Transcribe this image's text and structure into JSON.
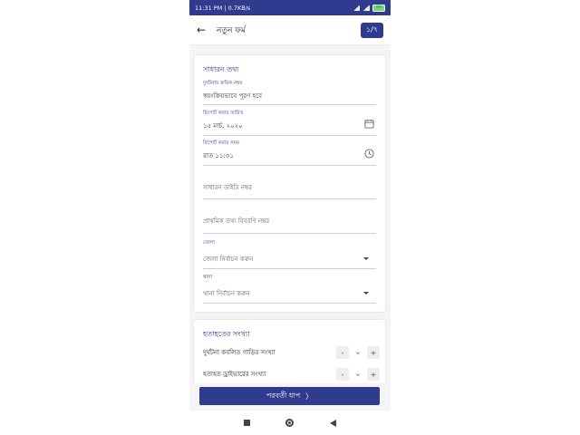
{
  "status_bar": {
    "left_text": "11:31 PM | 0.7KB/s",
    "battery": "99"
  },
  "app_bar": {
    "title": "নতুন ফর্ম",
    "step": "১/৭"
  },
  "general_info": {
    "title": "সাধারন তথ্য",
    "accident_serial": {
      "label": "দুর্ঘটনার ক্রমিক নম্বর",
      "value": "স্বয়ংক্রিয়ভাবে পূরণ হবে"
    },
    "report_date": {
      "label": "রিপোর্ট করার তারিখ",
      "value": "১৫ মার্চ, ২০২০",
      "icon": "calendar-icon"
    },
    "report_time": {
      "label": "রিপোর্ট করার সময়",
      "value": "রাত ১১:৩১",
      "icon": "clock-icon"
    },
    "gd_number": {
      "placeholder": "সাধারন ডাইরি নম্বর"
    },
    "fir_number": {
      "placeholder": "প্রাথমিক তথ্য বিবরণি নম্বর"
    },
    "district": {
      "label": "জেলা",
      "placeholder": "জেলা নির্বাচন করুন"
    },
    "police_station": {
      "label": "থানা",
      "placeholder": "থানা নির্বাচন করুন"
    }
  },
  "casualties": {
    "title": "হতাহতের সংখ্যা",
    "rows": [
      {
        "label": "দুর্ঘটনা কবলিত গাড়ির সংখ্যা",
        "value": "০",
        "minus": "-",
        "plus": "+"
      },
      {
        "label": "হতাহত ড্রাইভারের সংখ্যা",
        "value": "০",
        "minus": "-",
        "plus": "+"
      }
    ]
  },
  "next_button": {
    "label": "পরবর্তী ধাপ",
    "arrow": "〉"
  },
  "colors": {
    "primary": "#2e3b8e"
  }
}
